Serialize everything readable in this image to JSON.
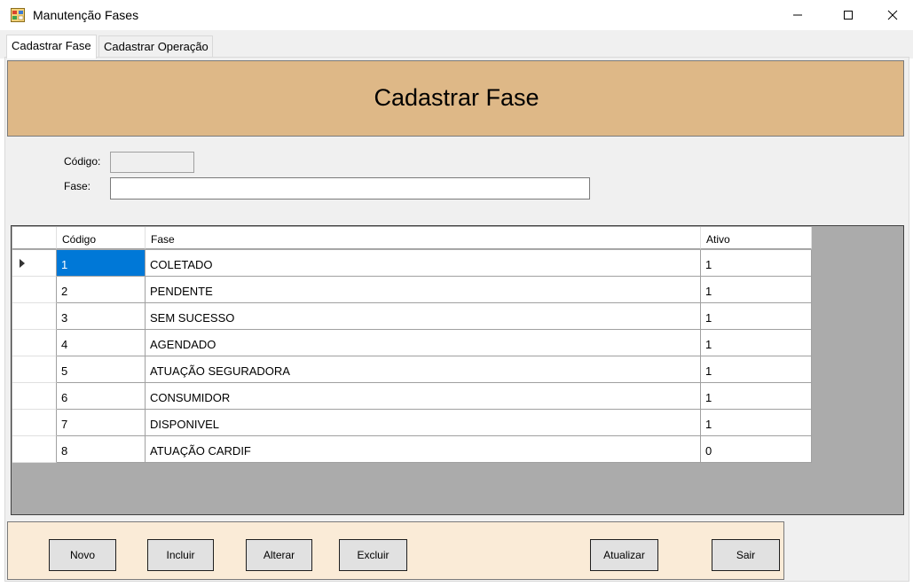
{
  "window": {
    "title": "Manutenção Fases",
    "app_icon": "forms-app-icon",
    "controls": {
      "minimize": "─",
      "maximize": "☐",
      "close": "✕"
    }
  },
  "tabs": [
    {
      "label": "Cadastrar Fase",
      "active": true
    },
    {
      "label": "Cadastrar Operação",
      "active": false
    }
  ],
  "banner": {
    "title": "Cadastrar Fase",
    "color": "#deb887"
  },
  "form": {
    "codigo_label": "Código:",
    "codigo_value": "",
    "fase_label": "Fase:",
    "fase_value": ""
  },
  "grid": {
    "columns": [
      "Código",
      "Fase",
      "Ativo"
    ],
    "rows": [
      {
        "codigo": "1",
        "fase": "COLETADO",
        "ativo": "1"
      },
      {
        "codigo": "2",
        "fase": "PENDENTE",
        "ativo": "1"
      },
      {
        "codigo": "3",
        "fase": "SEM SUCESSO",
        "ativo": "1"
      },
      {
        "codigo": "4",
        "fase": "AGENDADO",
        "ativo": "1"
      },
      {
        "codigo": "5",
        "fase": "ATUAÇÃO SEGURADORA",
        "ativo": "1"
      },
      {
        "codigo": "6",
        "fase": "CONSUMIDOR",
        "ativo": "1"
      },
      {
        "codigo": "7",
        "fase": "DISPONIVEL",
        "ativo": "1"
      },
      {
        "codigo": "8",
        "fase": "ATUAÇÃO CARDIF",
        "ativo": "0"
      }
    ],
    "selected_row": 0,
    "selection_color": "#0078d7"
  },
  "buttons": {
    "novo": "Novo",
    "incluir": "Incluir",
    "alterar": "Alterar",
    "excluir": "Excluir",
    "atualizar": "Atualizar",
    "sair": "Sair"
  },
  "buttonbar_color": "#faebd7"
}
